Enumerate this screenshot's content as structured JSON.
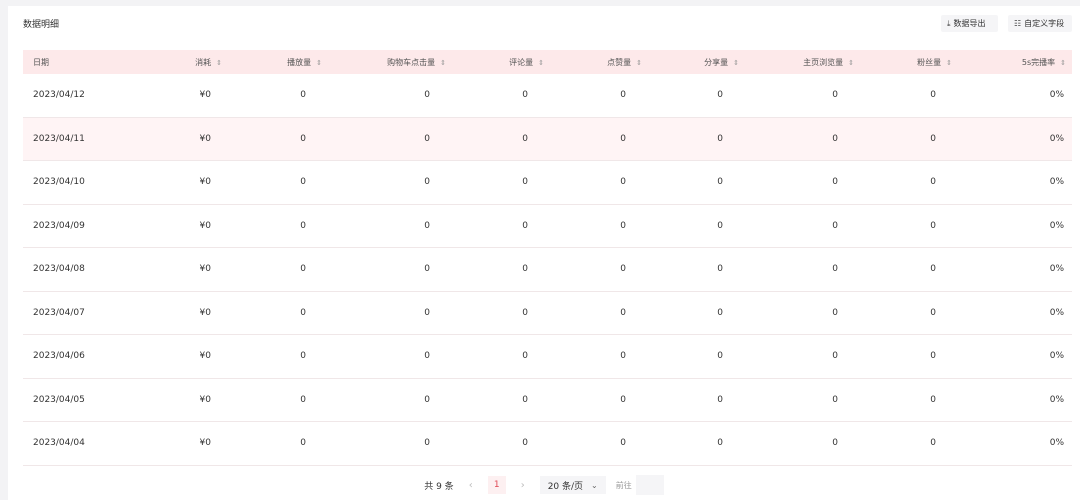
{
  "section": {
    "title": "数据明细"
  },
  "toolbar": {
    "export_label": "数据导出",
    "export_icon": "download-icon",
    "custom_label": "自定义字段",
    "custom_icon": "columns-icon"
  },
  "table": {
    "columns": [
      "日期",
      "消耗",
      "播放量",
      "购物车点击量",
      "评论量",
      "点赞量",
      "分享量",
      "主页浏览量",
      "粉丝量",
      "5s完播率"
    ],
    "sort_icon": "⇕",
    "rows": [
      [
        "2023/04/12",
        "¥0",
        "0",
        "0",
        "0",
        "0",
        "0",
        "0",
        "0",
        "0%"
      ],
      [
        "2023/04/11",
        "¥0",
        "0",
        "0",
        "0",
        "0",
        "0",
        "0",
        "0",
        "0%"
      ],
      [
        "2023/04/10",
        "¥0",
        "0",
        "0",
        "0",
        "0",
        "0",
        "0",
        "0",
        "0%"
      ],
      [
        "2023/04/09",
        "¥0",
        "0",
        "0",
        "0",
        "0",
        "0",
        "0",
        "0",
        "0%"
      ],
      [
        "2023/04/08",
        "¥0",
        "0",
        "0",
        "0",
        "0",
        "0",
        "0",
        "0",
        "0%"
      ],
      [
        "2023/04/07",
        "¥0",
        "0",
        "0",
        "0",
        "0",
        "0",
        "0",
        "0",
        "0%"
      ],
      [
        "2023/04/06",
        "¥0",
        "0",
        "0",
        "0",
        "0",
        "0",
        "0",
        "0",
        "0%"
      ],
      [
        "2023/04/05",
        "¥0",
        "0",
        "0",
        "0",
        "0",
        "0",
        "0",
        "0",
        "0%"
      ],
      [
        "2023/04/04",
        "¥0",
        "0",
        "0",
        "0",
        "0",
        "0",
        "0",
        "0",
        "0%"
      ]
    ]
  },
  "pager": {
    "total": "共 9 条",
    "prev": "‹",
    "current": "1",
    "next": "›",
    "page_size": "20 条/页",
    "goto_label": "前往"
  },
  "colors": {
    "header_bg": "#fde9ea",
    "row_alt_bg": "#fff4f5",
    "accent": "#e04a56"
  }
}
